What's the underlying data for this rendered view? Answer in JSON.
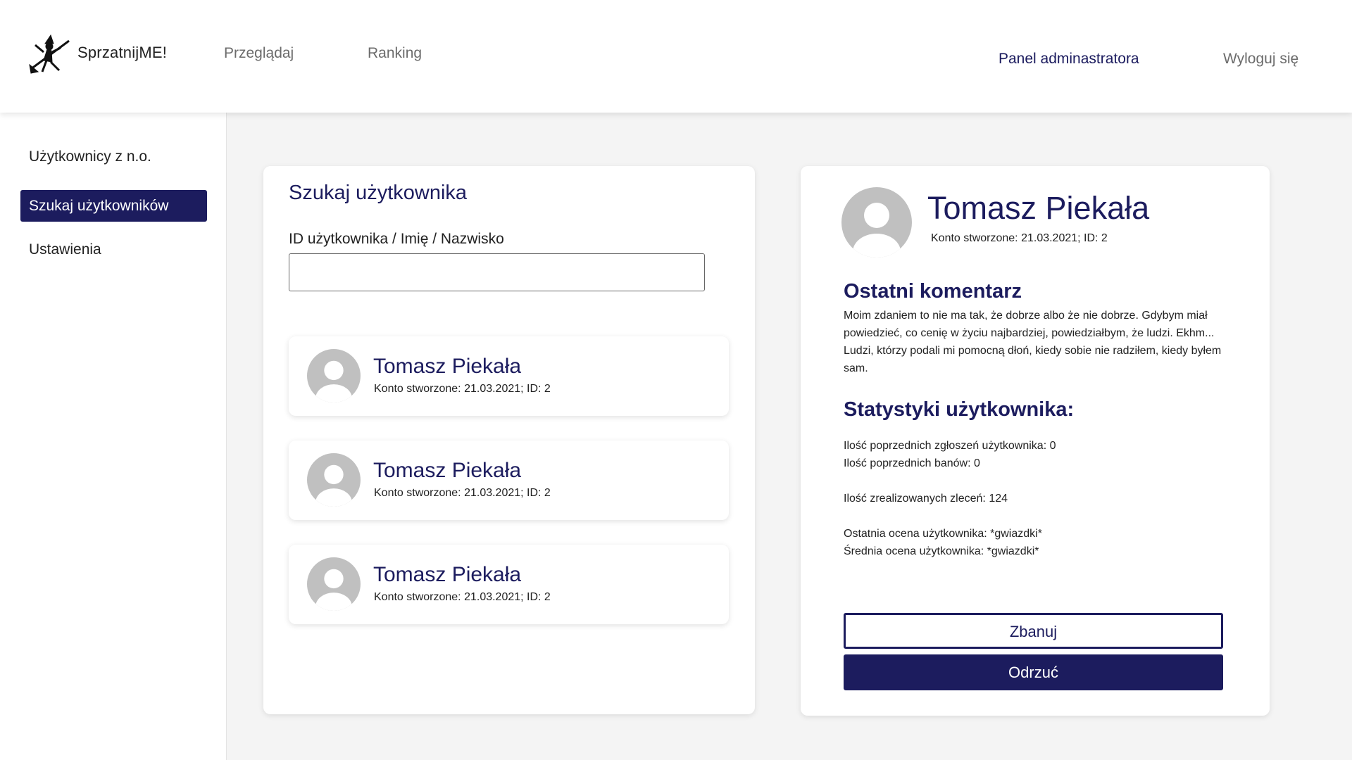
{
  "header": {
    "brand": "SprzatnijME!",
    "nav": {
      "browse": "Przeglądaj",
      "ranking": "Ranking"
    },
    "admin_panel": "Panel adminastratora",
    "logout": "Wyloguj się"
  },
  "sidebar": {
    "items": [
      {
        "label": "Użytkownicy z n.o."
      },
      {
        "label": "Szukaj użytkowników",
        "active": true
      },
      {
        "label": "Ustawienia"
      }
    ]
  },
  "search": {
    "title": "Szukaj użytkownika",
    "field_label": "ID użytkownika / Imię / Nazwisko",
    "value": "",
    "placeholder": "",
    "results": [
      {
        "name": "Tomasz Piekała",
        "meta": "Konto stworzone: 21.03.2021; ID: 2"
      },
      {
        "name": "Tomasz Piekała",
        "meta": "Konto stworzone: 21.03.2021; ID: 2"
      },
      {
        "name": "Tomasz Piekała",
        "meta": "Konto stworzone: 21.03.2021; ID: 2"
      }
    ]
  },
  "detail": {
    "name": "Tomasz Piekała",
    "meta": "Konto stworzone: 21.03.2021; ID: 2",
    "comment_title": "Ostatni komentarz",
    "comment": "Moim zdaniem to nie ma tak, że dobrze albo że nie dobrze. Gdybym miał powiedzieć, co cenię w życiu najbardziej, powiedziałbym, że ludzi. Ekhm... Ludzi, którzy podali mi pomocną dłoń, kiedy sobie nie radziłem, kiedy byłem sam.",
    "stats_title": "Statystyki użytkownika:",
    "stats": [
      "Ilość poprzednich zgłoszeń użytkownika: 0",
      "Ilość poprzednich banów: 0",
      "Ilość zrealizowanych zleceń: 124",
      "Ostatnia ocena użytkownika: *gwiazdki*",
      "Średnia ocena użytkownika: *gwiazdki*"
    ],
    "ban_label": "Zbanuj",
    "reject_label": "Odrzuć"
  },
  "colors": {
    "accent": "#1c1c5e",
    "background": "#f4f4f4",
    "avatar": "#c0c0c0"
  },
  "icons": {
    "logo": "broom-witch-logo",
    "avatar": "user-avatar-icon"
  }
}
